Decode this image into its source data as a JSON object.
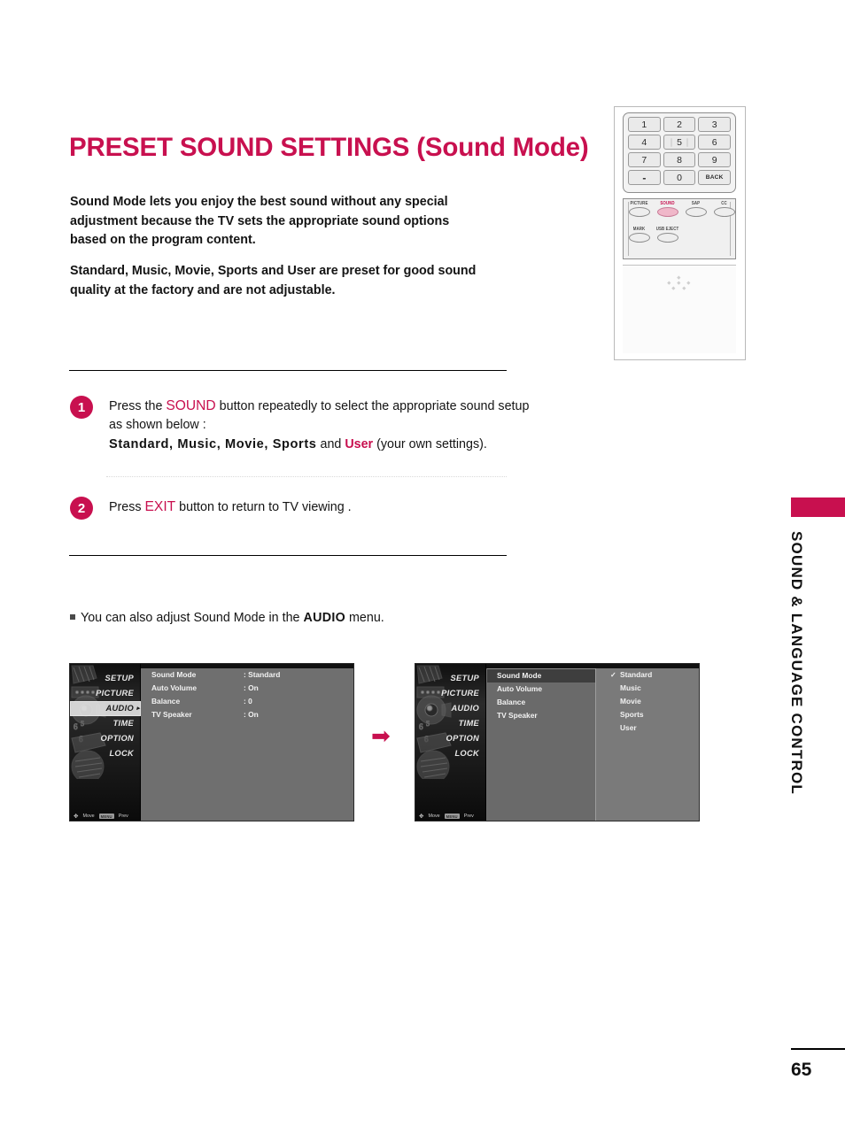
{
  "document": {
    "title_main": "PRESET SOUND SETTINGS",
    "title_sub": "(Sound Mode)",
    "page_number": "65",
    "side_tab_label": "SOUND & LANGUAGE CONTROL",
    "accent_color": "#C8104F"
  },
  "intro": {
    "paragraph_1": "Sound Mode lets you enjoy the best sound without any special adjustment because the TV sets the appropriate sound options based on the program content.",
    "paragraph_2": "Standard, Music, Movie, Sports and User are preset for good sound quality at the factory and are not adjustable."
  },
  "remote": {
    "keypad": [
      "1",
      "2",
      "3",
      "4",
      "5",
      "6",
      "7",
      "8",
      "9",
      "-",
      "0",
      "BACK"
    ],
    "function_row_1": [
      "PICTURE",
      "SOUND",
      "SAP",
      "CC"
    ],
    "function_row_2": [
      "MARK",
      "USB EJECT"
    ],
    "highlighted_button": "SOUND"
  },
  "steps": [
    {
      "number": "1",
      "line_1_a": "Press the ",
      "line_1_key": "SOUND",
      "line_1_b": " button repeatedly to select the appropriate sound setup as shown below :",
      "line_2_modes": "Standard, Music, Movie, Sports",
      "line_2_and": " and ",
      "line_2_user": "User",
      "line_2_tail": " (your own settings)."
    },
    {
      "number": "2",
      "line_1_a": "Press ",
      "line_1_key": "EXIT",
      "line_1_b": " button to return to TV viewing ."
    }
  ],
  "note": {
    "bullet_text_a": "You can also adjust Sound Mode in the ",
    "bullet_text_menu": "AUDIO",
    "bullet_text_b": " menu."
  },
  "osd": {
    "sidebar_items": [
      "SETUP",
      "PICTURE",
      "AUDIO",
      "TIME",
      "OPTION",
      "LOCK"
    ],
    "sidebar_active_panel_1": "AUDIO",
    "sidebar_active_panel_2": "AUDIO",
    "footer_move": "Move",
    "footer_menu_badge": "MENU",
    "footer_prev": "Prev",
    "panel_1": {
      "rows": [
        {
          "label": "Sound Mode",
          "value": ": Standard"
        },
        {
          "label": "Auto Volume",
          "value": ": On"
        },
        {
          "label": "Balance",
          "value": ": 0"
        },
        {
          "label": "TV Speaker",
          "value": ": On"
        }
      ]
    },
    "panel_2": {
      "rows": [
        {
          "label": "Sound Mode",
          "value": ""
        },
        {
          "label": "Auto Volume",
          "value": ""
        },
        {
          "label": "Balance",
          "value": ""
        },
        {
          "label": "TV Speaker",
          "value": ""
        }
      ],
      "highlighted_row": "Sound Mode",
      "submenu_arrow": "▶",
      "options": [
        {
          "label": "Standard",
          "checked": "✓"
        },
        {
          "label": "Music",
          "checked": ""
        },
        {
          "label": "Movie",
          "checked": ""
        },
        {
          "label": "Sports",
          "checked": ""
        },
        {
          "label": "User",
          "checked": ""
        }
      ]
    },
    "flow_arrow": "➡"
  }
}
